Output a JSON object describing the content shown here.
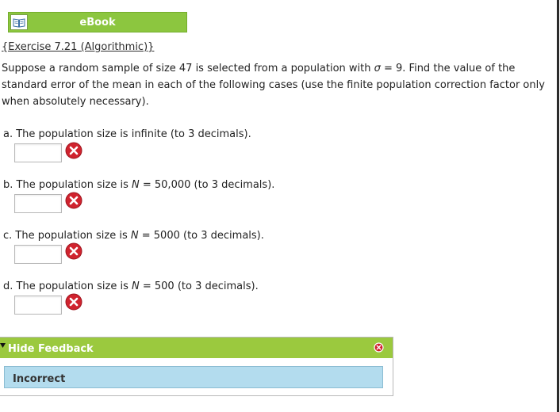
{
  "ebook": {
    "label": "eBook",
    "icon": "book-icon"
  },
  "exercise": {
    "link_text": "{Exercise 7.21 (Algorithmic)}"
  },
  "problem": {
    "text_before_sigma": "Suppose a random sample of size 47 is selected from a population with ",
    "sigma": "σ",
    "text_after_sigma": " = 9. Find the value of the standard error of the mean in each of the following cases (use the finite population correction factor only when absolutely necessary)."
  },
  "parts": [
    {
      "prefix": "a. The population size is infinite (to 3 decimals).",
      "N": "",
      "suffix": "",
      "value": ""
    },
    {
      "prefix": "b. The population size is ",
      "N": "N",
      "suffix": " = 50,000 (to 3 decimals).",
      "value": ""
    },
    {
      "prefix": "c. The population size is ",
      "N": "N",
      "suffix": " = 5000 (to 3 decimals).",
      "value": ""
    },
    {
      "prefix": "d. The population size is ",
      "N": "N",
      "suffix": " = 500 (to 3 decimals).",
      "value": ""
    }
  ],
  "feedback": {
    "toggle_label": "Hide Feedback",
    "message": "Incorrect"
  },
  "colors": {
    "accent_green": "#8cc63f",
    "error_red": "#d0232e",
    "feedback_blue": "#b3dcee"
  }
}
